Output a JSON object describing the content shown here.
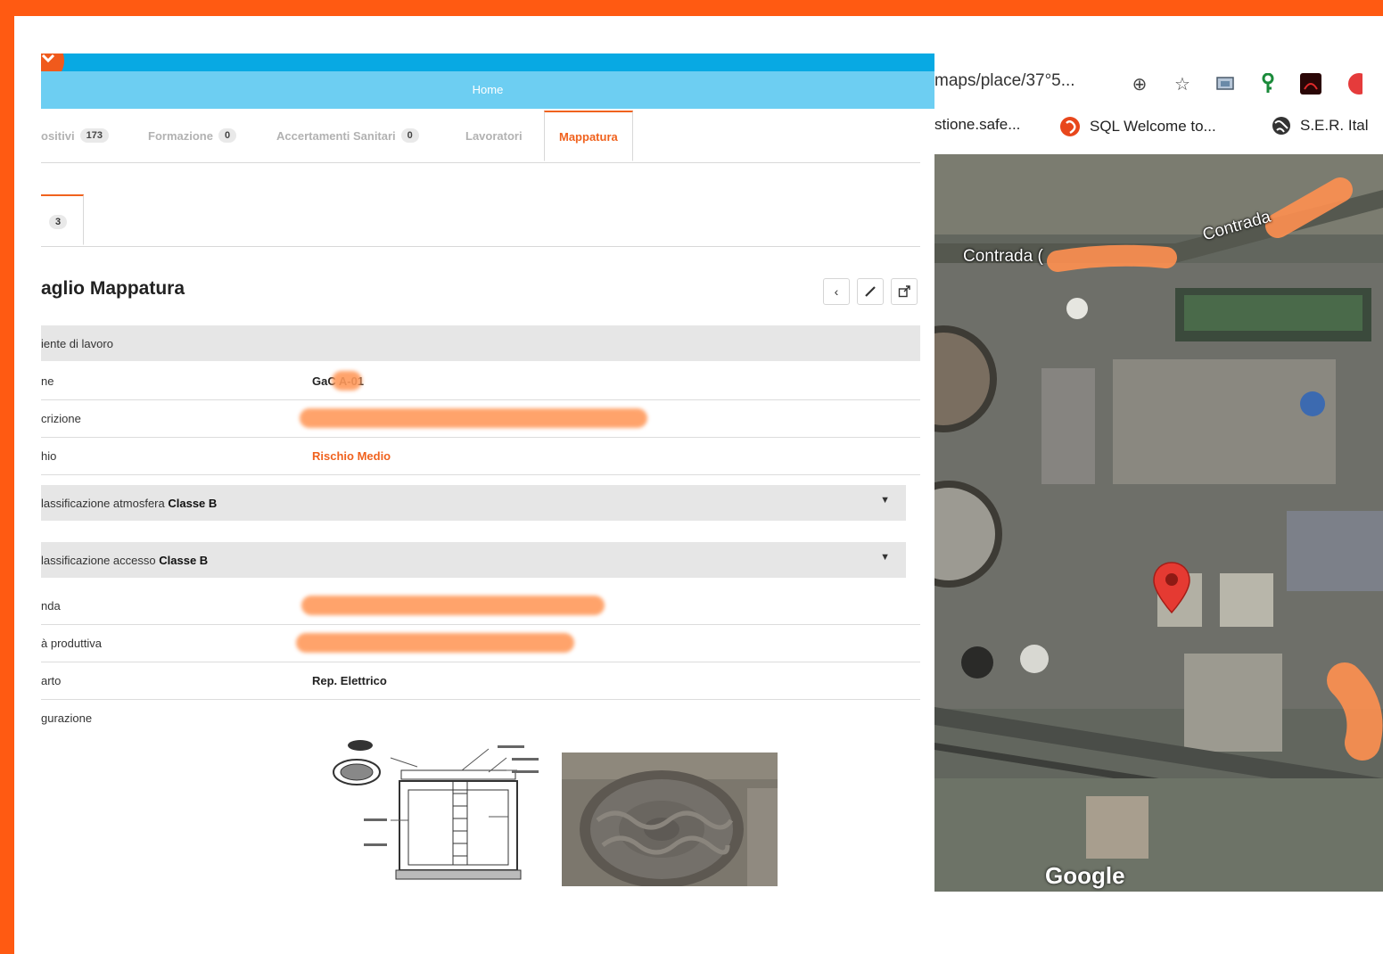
{
  "app": {
    "header_title": "Home",
    "tabs": [
      {
        "label": "ositivi",
        "count": "173"
      },
      {
        "label": "Formazione",
        "count": "0"
      },
      {
        "label": "Accertamenti Sanitari",
        "count": "0"
      },
      {
        "label": "Lavoratori",
        "count": ""
      },
      {
        "label": "Mappatura",
        "count": ""
      }
    ],
    "subtab_count": "3",
    "page_title": "aglio Mappatura",
    "section_title": "iente di lavoro",
    "rows": {
      "name_label": "ne",
      "name_value": "GaC   A-01",
      "description_label": "crizione",
      "risk_label": "hio",
      "risk_value": "Rischio Medio",
      "company_label": "nda",
      "production_label": "à produttiva",
      "department_label": "arto",
      "department_value": "Rep. Elettrico",
      "config_label": "gurazione"
    },
    "collapses": {
      "atmosphere_label": "lassificazione atmosfera",
      "atmosphere_value": "Classe B",
      "access_label": "lassificazione accesso",
      "access_value": "Classe B"
    },
    "accent_color": "#f0621e"
  },
  "browser": {
    "url": "maps/place/37°5...",
    "bookmarks": [
      {
        "label": "stione.safe..."
      },
      {
        "label": "SQL Welcome to..."
      },
      {
        "label": "S.E.R. Ital"
      }
    ],
    "map": {
      "road_label_1": "Contrada (",
      "road_label_2": "Contrada",
      "attribution": "Google"
    }
  }
}
